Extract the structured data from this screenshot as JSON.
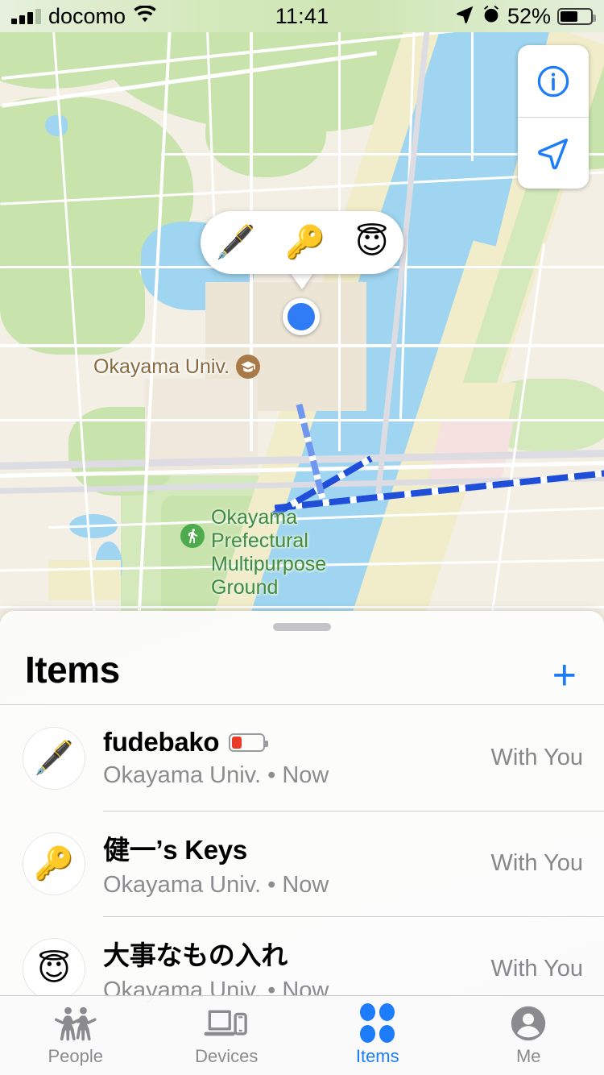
{
  "status_bar": {
    "carrier": "docomo",
    "wifi_icon": "wifi-icon",
    "time": "11:41",
    "location_icon": "location-arrow-icon",
    "alarm_icon": "alarm-clock-icon",
    "battery_percent": "52%",
    "battery_level": 52
  },
  "map": {
    "controls": [
      {
        "name": "info-button",
        "icon": "info-circle-icon"
      },
      {
        "name": "locate-button",
        "icon": "location-arrow-icon"
      }
    ],
    "callout": {
      "items": [
        {
          "emoji": "🖋️",
          "name": "fountain-pen-emoji"
        },
        {
          "emoji": "🔑",
          "name": "key-emoji"
        },
        {
          "emoji": "😇",
          "name": "halo-face-emoji"
        }
      ]
    },
    "user_location_label": "current-location-dot",
    "labels": [
      {
        "text": "Okayama Univ.",
        "icon": "graduation-cap-icon",
        "color": "#8a6a3f"
      },
      {
        "text": "Okayama Prefectural Multipurpose Ground",
        "icon": "running-person-icon",
        "color": "#3f8b3f"
      }
    ],
    "colors": {
      "land": "#f3efe4",
      "park": "#c9e3ad",
      "water": "#9fd5f0",
      "road": "#ffffff",
      "highway": "#1f4fd8",
      "accent_blue": "#2f7cf6"
    }
  },
  "sheet": {
    "title": "Items",
    "add_label": "+",
    "items": [
      {
        "emoji": "🖋️",
        "icon_name": "fountain-pen-emoji",
        "title": "fudebako",
        "subtitle": "Okayama Univ. • Now",
        "status": "With You",
        "battery": {
          "shown": true,
          "level": 28,
          "color": "#ea3b2a"
        }
      },
      {
        "emoji": "🔑",
        "icon_name": "key-emoji",
        "title": "健一’s Keys",
        "subtitle": "Okayama Univ. • Now",
        "status": "With You",
        "battery": {
          "shown": false,
          "level": 0,
          "color": ""
        }
      },
      {
        "emoji": "😇",
        "icon_name": "halo-face-emoji",
        "title": "大事なもの入れ",
        "subtitle": "Okayama Univ. • Now",
        "status": "With You",
        "battery": {
          "shown": false,
          "level": 0,
          "color": ""
        }
      }
    ]
  },
  "tab_bar": {
    "active": "Items",
    "accent_color": "#1c7cf9",
    "inactive_color": "#8b8b8f",
    "tabs": [
      {
        "label": "People",
        "icon": "two-people-icon"
      },
      {
        "label": "Devices",
        "icon": "laptop-phone-icon"
      },
      {
        "label": "Items",
        "icon": "four-dots-icon"
      },
      {
        "label": "Me",
        "icon": "person-circle-icon"
      }
    ]
  }
}
